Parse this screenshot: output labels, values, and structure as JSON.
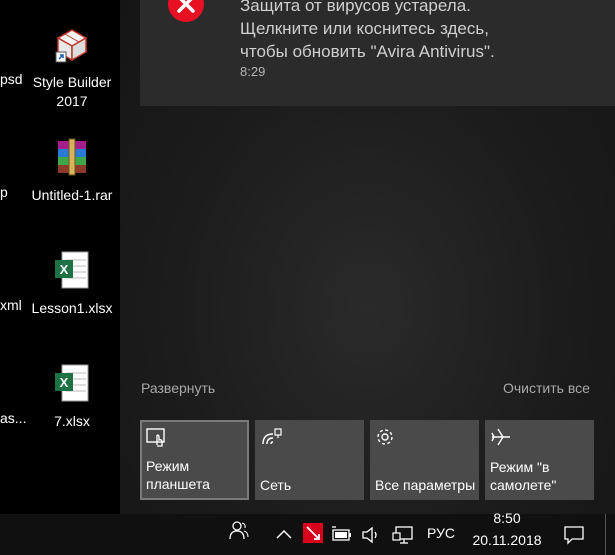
{
  "desktop": {
    "items": [
      {
        "label_line1": "Style Builder",
        "label_line2": "2017"
      },
      {
        "label_line1": "Untitled-1.rar"
      },
      {
        "label_line1": "Lesson1.xlsx"
      },
      {
        "label_line1": "7.xlsx"
      }
    ],
    "cut_labels": [
      "psd",
      "p",
      "xml",
      "as..."
    ]
  },
  "notification": {
    "line1": "Защита от вирусов устарела.",
    "line2": "Щелкните или коснитесь здесь,",
    "line3": "чтобы обновить \"Avira Antivirus\".",
    "time": "8:29"
  },
  "action_center": {
    "expand_label": "Развернуть",
    "clear_label": "Очистить все",
    "tiles": [
      {
        "line1": "Режим",
        "line2": "планшета",
        "icon": "tablet-mode-icon"
      },
      {
        "line1": "",
        "line2": "Сеть",
        "icon": "network-icon"
      },
      {
        "line1": "",
        "line2": "Все параметры",
        "icon": "gear-icon"
      },
      {
        "line1": "Режим \"в",
        "line2": "самолете\"",
        "icon": "airplane-icon"
      }
    ]
  },
  "taskbar": {
    "language": "РУС",
    "time": "8:50",
    "date": "20.11.2018"
  },
  "colors": {
    "notification_error": "#e81123",
    "tile_bg": "#4a4a4a",
    "taskbar_bg": "#101010"
  }
}
